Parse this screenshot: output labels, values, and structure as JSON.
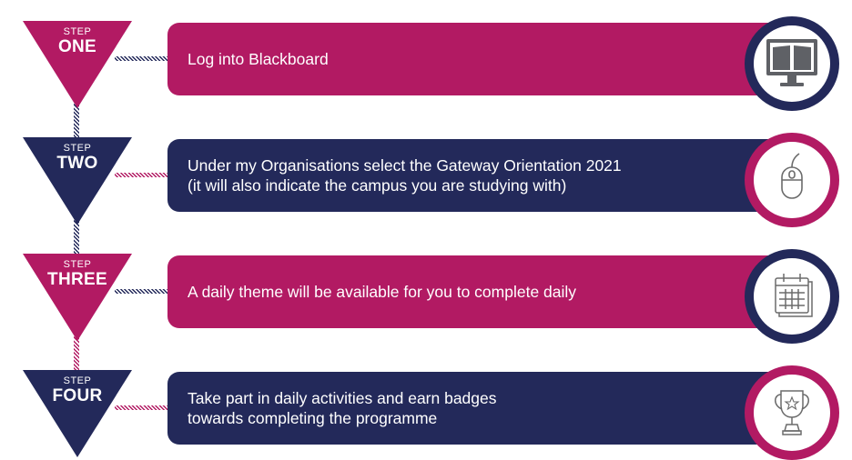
{
  "colors": {
    "magenta": "#b21a63",
    "navy": "#23295a",
    "icon_stroke": "#6b6b6b"
  },
  "steps": [
    {
      "label": "STEP",
      "number": "ONE",
      "text": [
        "Log into Blackboard"
      ],
      "banner_color": "magenta",
      "ring_color": "navy",
      "icon": "computer-book-icon"
    },
    {
      "label": "STEP",
      "number": "TWO",
      "text": [
        "Under my Organisations select the Gateway Orientation 2021",
        "(it will also indicate the campus you are studying with)"
      ],
      "banner_color": "navy",
      "ring_color": "magenta",
      "icon": "mouse-icon"
    },
    {
      "label": "STEP",
      "number": "THREE",
      "text": [
        "A daily theme will be available for you to complete daily"
      ],
      "banner_color": "magenta",
      "ring_color": "navy",
      "icon": "calendar-icon"
    },
    {
      "label": "STEP",
      "number": "FOUR",
      "text": [
        "Take part in daily activities and earn badges",
        "towards completing the programme"
      ],
      "banner_color": "navy",
      "ring_color": "magenta",
      "icon": "trophy-icon"
    }
  ]
}
